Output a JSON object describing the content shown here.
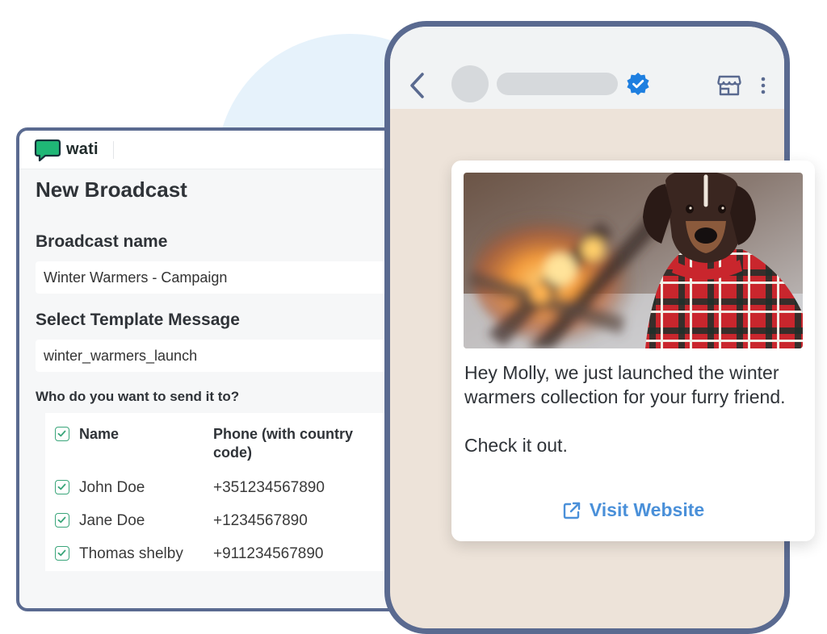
{
  "brand": {
    "name": "wati"
  },
  "broadcast": {
    "title": "New Broadcast",
    "name_label": "Broadcast name",
    "name_value": "Winter Warmers - Campaign",
    "template_label": "Select Template Message",
    "template_value": "winter_warmers_launch",
    "recipients_label": "Who do you want to send it to?",
    "columns": {
      "name": "Name",
      "phone_line1": "Phone (with country",
      "phone_line2": "code)"
    },
    "recipients": [
      {
        "name": "John Doe",
        "phone": "+351234567890",
        "checked": true
      },
      {
        "name": "Jane Doe",
        "phone": "+1234567890",
        "checked": true
      },
      {
        "name": "Thomas shelby",
        "phone": "+911234567890",
        "checked": true
      }
    ]
  },
  "chat": {
    "icons": [
      "back-arrow-icon",
      "verified-badge-icon",
      "shop-icon",
      "more-vertical-icon"
    ],
    "message_line1": "Hey Molly, we just launched the winter warmers collection for your furry friend.",
    "message_line2": "Check it out.",
    "link_label": "Visit Website",
    "link_icon": "external-link-icon"
  },
  "colors": {
    "accent_green": "#3aa57a",
    "frame": "#5a6a90",
    "link_blue": "#4a90d9",
    "verified_blue": "#1e7fe0",
    "chat_bg": "#ede3d9"
  }
}
